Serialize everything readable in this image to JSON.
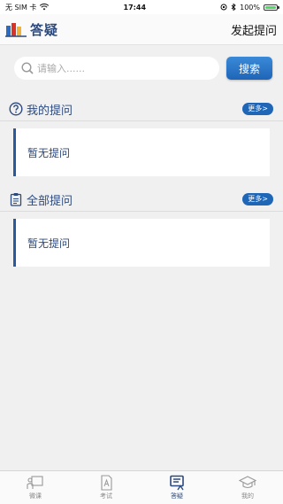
{
  "status_bar": {
    "carrier": "无 SIM 卡",
    "time": "17:44",
    "battery_percent": "100%",
    "battery_level": 1.0
  },
  "nav": {
    "title": "答疑",
    "action": "发起提问"
  },
  "search": {
    "placeholder": "请输入......",
    "value": "",
    "button_label": "搜索"
  },
  "sections": [
    {
      "title": "我的提问",
      "more_label": "更多>",
      "empty_text": "暂无提问",
      "icon": "question-circle-icon"
    },
    {
      "title": "全部提问",
      "more_label": "更多>",
      "empty_text": "暂无提问",
      "icon": "clipboard-icon"
    }
  ],
  "tabbar": {
    "items": [
      {
        "label": "微课",
        "icon": "lecture-icon",
        "active": false
      },
      {
        "label": "考试",
        "icon": "exam-icon",
        "active": false
      },
      {
        "label": "答疑",
        "icon": "qa-icon",
        "active": true
      },
      {
        "label": "我的",
        "icon": "graduation-cap-icon",
        "active": false
      }
    ]
  },
  "colors": {
    "accent": "#2d4a7e",
    "button_blue": "#1f66b7",
    "background": "#f0f0f0"
  }
}
